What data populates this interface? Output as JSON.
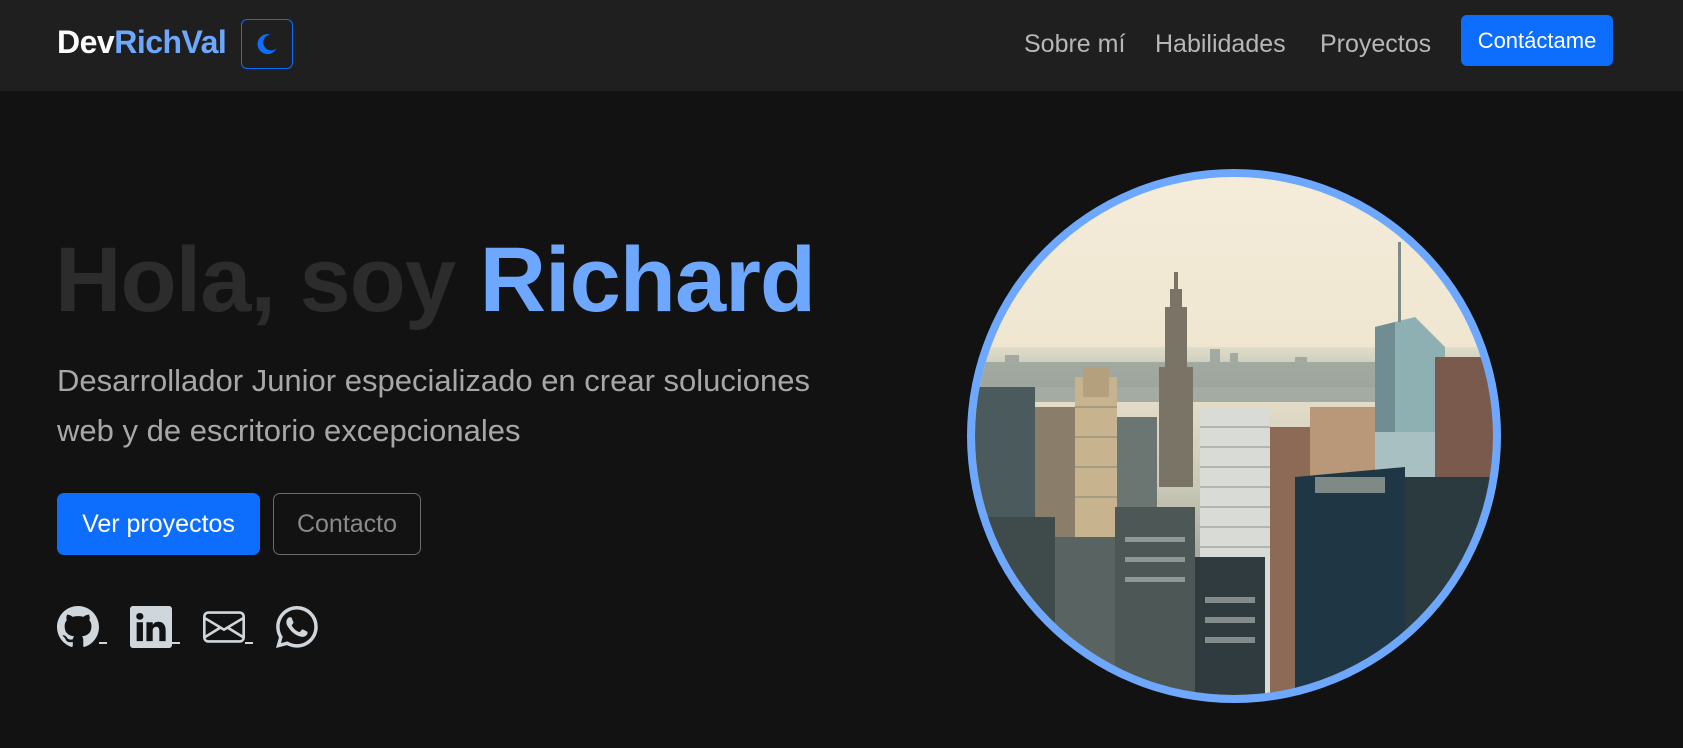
{
  "nav": {
    "brand_part1": "Dev",
    "brand_part2": "RichVal",
    "theme_toggle_icon": "moon-icon",
    "links": [
      "Sobre mí",
      "Habilidades",
      "Proyectos"
    ],
    "cta": "Contáctame"
  },
  "hero": {
    "greeting": "Hola, soy ",
    "name": "Richard",
    "subtitle_line1": "Desarrollador Junior especializado en crear soluciones",
    "subtitle_line2": "web y de escritorio excepcionales",
    "primary_button": "Ver proyectos",
    "secondary_button": "Contacto",
    "social_icons": [
      "github-icon",
      "linkedin-icon",
      "email-icon",
      "whatsapp-icon"
    ]
  },
  "photo": {
    "icon": "city-skyline-photo"
  },
  "colors": {
    "accent": "#6ea8fe",
    "primary": "#0d6efd",
    "background": "#121212",
    "navbar": "#1f1f1f"
  }
}
